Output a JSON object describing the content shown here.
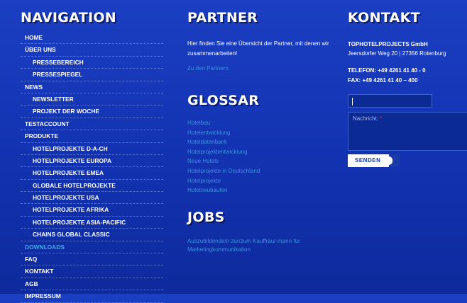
{
  "navigation": {
    "title": "NAVIGATION",
    "items": [
      {
        "label": "HOME",
        "sub": false,
        "active": false
      },
      {
        "label": "ÜBER UNS",
        "sub": false,
        "active": false
      },
      {
        "label": "PRESSEBEREICH",
        "sub": true,
        "active": false
      },
      {
        "label": "PRESSESPIEGEL",
        "sub": true,
        "active": false
      },
      {
        "label": "NEWS",
        "sub": false,
        "active": false
      },
      {
        "label": "NEWSLETTER",
        "sub": true,
        "active": false
      },
      {
        "label": "PROJEKT DER WOCHE",
        "sub": true,
        "active": false
      },
      {
        "label": "TESTACCOUNT",
        "sub": false,
        "active": false
      },
      {
        "label": "PRODUKTE",
        "sub": false,
        "active": false
      },
      {
        "label": "HOTELPROJEKTE D-A-CH",
        "sub": true,
        "active": false
      },
      {
        "label": "HOTELPROJEKTE EUROPA",
        "sub": true,
        "active": false
      },
      {
        "label": "HOTELPROJEKTE EMEA",
        "sub": true,
        "active": false
      },
      {
        "label": "GLOBALE HOTELPROJEKTE",
        "sub": true,
        "active": false
      },
      {
        "label": "HOTELPROJEKTE USA",
        "sub": true,
        "active": false
      },
      {
        "label": "HOTELPROJEKTE AFRIKA",
        "sub": true,
        "active": false
      },
      {
        "label": "HOTELPROJEKTE ASIA-PACIFIC",
        "sub": true,
        "active": false
      },
      {
        "label": "CHAINS GLOBAL CLASSIC",
        "sub": true,
        "active": false
      },
      {
        "label": "DOWNLOADS",
        "sub": false,
        "active": true
      },
      {
        "label": "FAQ",
        "sub": false,
        "active": false
      },
      {
        "label": "KONTAKT",
        "sub": false,
        "active": false
      },
      {
        "label": "AGB",
        "sub": false,
        "active": false
      },
      {
        "label": "IMPRESSUM",
        "sub": false,
        "active": false
      }
    ]
  },
  "partner": {
    "title": "PARTNER",
    "text": "Hier finden Sie eine Übersicht der Partner, mit denen wir zusammenarbeiten!",
    "link": "Zu den Partnern"
  },
  "glossar": {
    "title": "GLOSSAR",
    "items": [
      "Hotelbau",
      "Hotelentwicklung",
      "Hoteldatenbank",
      "Hotelprojektentwicklung",
      "Neue Hotels",
      "Hotelprojekte in Deutschland",
      "Hotelprojekte",
      "Hotelneubauten"
    ]
  },
  "jobs": {
    "title": "JOBS",
    "link": "Auszubildende/n zur/zum Kauffrau/-mann für Marketingkommunikation"
  },
  "kontakt": {
    "title": "KONTAKT",
    "company": "TOPHOTELPROJECTS GmbH",
    "address": "Jeersdorfer Weg 20 | 27356 Rotenburg",
    "telefon": "TELEFON: +49 4261 41 40 - 0",
    "fax": "FAX: +49 4261 41 40 – 400",
    "name_value": "",
    "message_label": "Nachricht:",
    "required_mark": "*",
    "send_label": "SENDEN"
  }
}
